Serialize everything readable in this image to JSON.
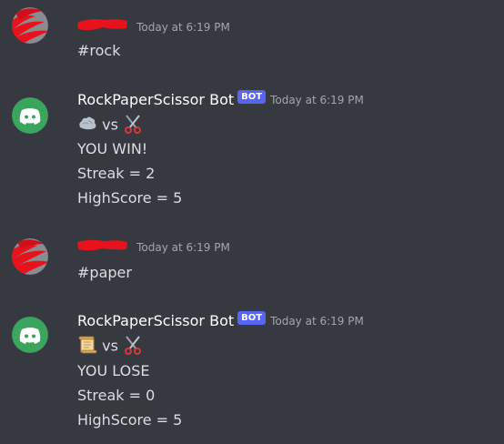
{
  "messages": [
    {
      "author": "",
      "author_redacted": true,
      "is_bot": false,
      "timestamp": "Today at 6:19 PM",
      "lines": [
        "#rock"
      ]
    },
    {
      "author": "RockPaperScissor Bot",
      "is_bot": true,
      "bot_tag": "BOT",
      "timestamp": "Today at 6:19 PM",
      "move_line": {
        "left_icon": "rock-emoji",
        "vs": "vs",
        "right_icon": "scissors-emoji"
      },
      "lines": [
        "YOU WIN!",
        "Streak = 2",
        "HighScore = 5"
      ]
    },
    {
      "author": "",
      "author_redacted": true,
      "is_bot": false,
      "timestamp": "Today at 6:19 PM",
      "lines": [
        "#paper"
      ]
    },
    {
      "author": "RockPaperScissor Bot",
      "is_bot": true,
      "bot_tag": "BOT",
      "timestamp": "Today at 6:19 PM",
      "move_line": {
        "left_icon": "scroll-emoji",
        "vs": "vs",
        "right_icon": "scissors-emoji"
      },
      "lines": [
        "YOU LOSE",
        "Streak = 0",
        "HighScore = 5"
      ]
    }
  ],
  "colors": {
    "background": "#36393f",
    "bot_tag": "#5865f2",
    "discord_avatar": "#3ba55d",
    "redaction": "#e8121c"
  }
}
